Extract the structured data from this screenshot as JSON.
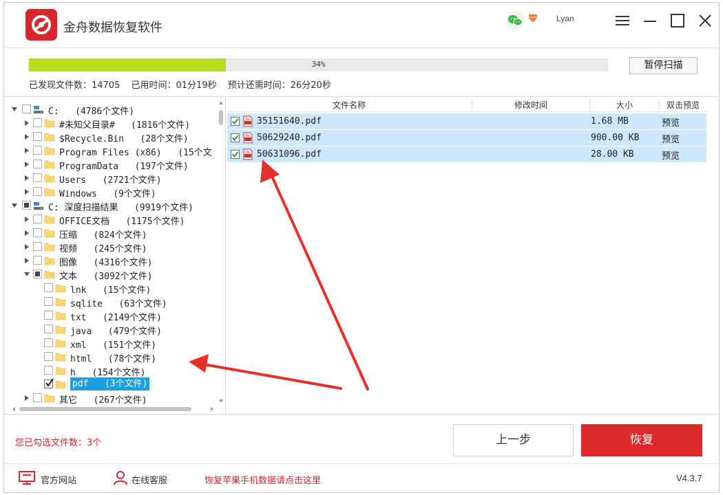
{
  "window": {
    "title": "金舟数据恢复软件",
    "username": "Lyan",
    "icons": [
      "logo-icon",
      "wechat-icon",
      "vip-icon",
      "menu-icon",
      "minimize-icon",
      "maximize-icon",
      "close-icon"
    ]
  },
  "scan": {
    "progress_percent": 34,
    "progress_label": "34%",
    "pause_label": "暂停扫描",
    "found_files": "已发现文件数：14705",
    "elapsed": "已用时间：01分19秒",
    "remaining": "预计还需时间：26分20秒"
  },
  "tree": {
    "drive_c": {
      "label": "C:",
      "count": "(4786个文件)"
    },
    "items_c": [
      {
        "label": "#未知父目录#",
        "count": "(1816个文件)"
      },
      {
        "label": "$Recycle.Bin",
        "count": "(28个文件)"
      },
      {
        "label": "Program Files (x86)",
        "count": "(15个文"
      },
      {
        "label": "ProgramData",
        "count": "(197个文件)"
      },
      {
        "label": "Users",
        "count": "(2721个文件)"
      },
      {
        "label": "Windows",
        "count": "(9个文件)"
      }
    ],
    "deep_scan": {
      "label": "C: 深度扫描结果",
      "count": "(9919个文件)"
    },
    "items_deep": [
      {
        "label": "OFFICE文档",
        "count": "(1175个文件)"
      },
      {
        "label": "压缩",
        "count": "(824个文件)"
      },
      {
        "label": "视频",
        "count": "(245个文件)"
      },
      {
        "label": "图像",
        "count": "(4316个文件)"
      },
      {
        "label": "文本",
        "count": "(3092个文件)"
      }
    ],
    "items_text": [
      {
        "label": "lnk",
        "count": "(15个文件)"
      },
      {
        "label": "sqlite",
        "count": "(63个文件)"
      },
      {
        "label": "txt",
        "count": "(2149个文件)"
      },
      {
        "label": "java",
        "count": "(479个文件)"
      },
      {
        "label": "xml",
        "count": "(151个文件)"
      },
      {
        "label": "html",
        "count": "(78个文件)"
      },
      {
        "label": "h",
        "count": "(154个文件)"
      },
      {
        "label": "pdf",
        "count": "(3个文件)"
      }
    ],
    "other": {
      "label": "其它",
      "count": "(267个文件)"
    }
  },
  "file_list": {
    "columns": [
      "文件名称",
      "修改时间",
      "大小",
      "双击预览"
    ],
    "rows": [
      {
        "name": "35151640.pdf",
        "size": "1.68 MB",
        "preview": "预览"
      },
      {
        "name": "50629240.pdf",
        "size": "900.00 KB",
        "preview": "预览"
      },
      {
        "name": "50631096.pdf",
        "size": "28.00 KB",
        "preview": "预览"
      }
    ]
  },
  "actions": {
    "selected_count": "您已勾选文件数：3个",
    "prev_label": "上一步",
    "recover_label": "恢复"
  },
  "footer": {
    "website": "官方网站",
    "support": "在线客服",
    "apple_link": "恢复苹果手机数据请点击这里",
    "version": "V4.3.7"
  },
  "colors": {
    "brand_red": "#d9262c",
    "progress_green": "#b7e01e",
    "selection_blue": "#1aa0e0",
    "row_highlight": "#cde8fb",
    "annotation_red": "#e8302a"
  }
}
